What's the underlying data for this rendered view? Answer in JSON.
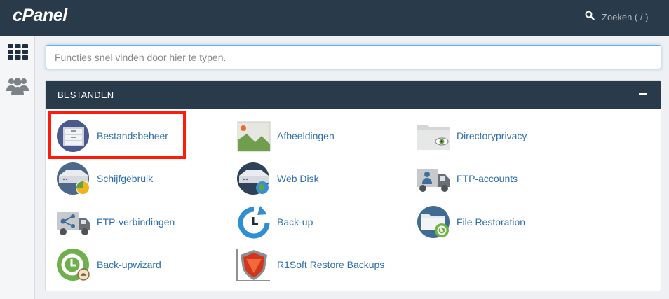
{
  "app": {
    "logo": "cPanel"
  },
  "topbar": {
    "search_label": "Zoeken ( / )",
    "search_icon": "search-icon"
  },
  "sidebar": {
    "items": [
      {
        "icon": "grid-icon"
      },
      {
        "icon": "users-icon"
      }
    ]
  },
  "search": {
    "placeholder": "Functies snel vinden door hier te typen.",
    "value": ""
  },
  "section": {
    "title": "BESTANDEN",
    "collapse_icon": "minus-icon",
    "items": [
      {
        "label": "Bestandsbeheer",
        "icon": "file-manager-icon",
        "highlighted": true
      },
      {
        "label": "Afbeeldingen",
        "icon": "images-icon"
      },
      {
        "label": "Directoryprivacy",
        "icon": "directory-privacy-icon"
      },
      {
        "label": "Schijfgebruik",
        "icon": "disk-usage-icon"
      },
      {
        "label": "Web Disk",
        "icon": "web-disk-icon"
      },
      {
        "label": "FTP-accounts",
        "icon": "ftp-accounts-icon"
      },
      {
        "label": "FTP-verbindingen",
        "icon": "ftp-connections-icon"
      },
      {
        "label": "Back-up",
        "icon": "backup-icon"
      },
      {
        "label": "File Restoration",
        "icon": "file-restoration-icon"
      },
      {
        "label": "Back-upwizard",
        "icon": "backup-wizard-icon"
      },
      {
        "label": "R1Soft Restore Backups",
        "icon": "r1soft-icon"
      }
    ]
  },
  "colors": {
    "header": "#293a4a",
    "link": "#2d6fb0",
    "highlight": "#ff1a0a",
    "focus": "#66afe9"
  }
}
